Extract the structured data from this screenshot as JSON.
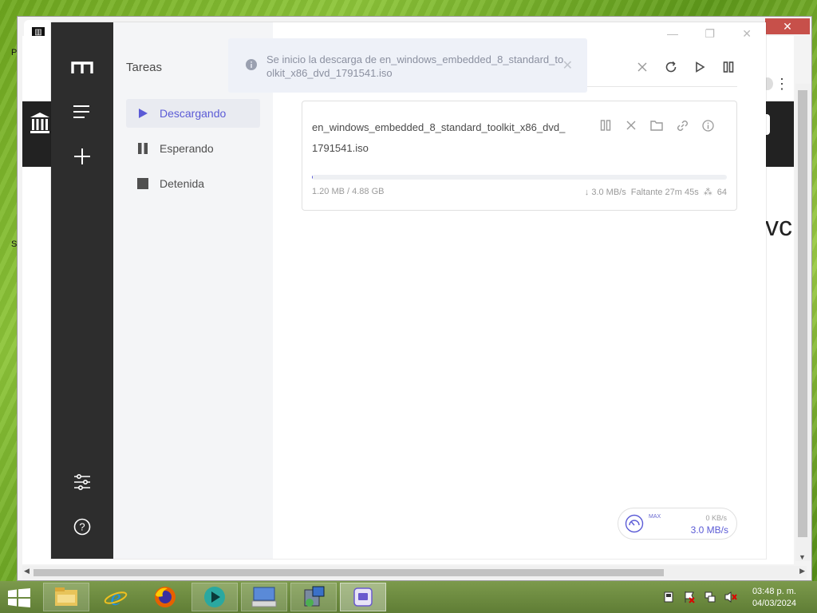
{
  "desktop": {
    "left_letters": [
      "P",
      "S"
    ]
  },
  "browser": {
    "close_label": "✕",
    "back_label": "←",
    "partial_text": "dvc"
  },
  "app": {
    "window_controls": {
      "minimize": "—",
      "maximize": "❐",
      "close": "✕"
    },
    "sidebar": {
      "logo_icon": "motrix-logo-icon",
      "items": [
        {
          "name": "menu-icon"
        },
        {
          "name": "add-icon"
        },
        {
          "name": "preferences-icon"
        },
        {
          "name": "help-icon"
        }
      ]
    },
    "subnav": {
      "title": "Tareas",
      "items": [
        {
          "label": "Descargando",
          "icon": "play-icon",
          "active": true
        },
        {
          "label": "Esperando",
          "icon": "pause-icon",
          "active": false
        },
        {
          "label": "Detenida",
          "icon": "stop-icon",
          "active": false
        }
      ]
    },
    "toolbar": {
      "buttons": [
        "close-icon",
        "refresh-icon",
        "resume-all-icon",
        "pause-all-icon"
      ]
    },
    "toast": {
      "message": "Se inicio la descarga de en_windows_embedded_8_standard_toolkit_x86_dvd_1791541.iso",
      "close": "✕"
    },
    "task": {
      "name": "en_windows_embedded_8_standard_toolkit_x86_dvd_1791541.iso",
      "progress": 0.0025,
      "size": "1.20 MB / 4.88 GB",
      "speed": "↓ 3.0 MB/s",
      "remaining": "Faltante 27m 45s",
      "connections": "64",
      "actions": [
        "pause-icon",
        "delete-icon",
        "folder-icon",
        "link-icon",
        "info-icon"
      ]
    },
    "speedometer": {
      "max_label": "MAX",
      "upload": "0 KB/s",
      "download": "3.0 MB/s"
    }
  },
  "taskbar": {
    "apps": [
      {
        "name": "file-explorer-icon",
        "state": "pinned"
      },
      {
        "name": "internet-explorer-icon",
        "state": "normal"
      },
      {
        "name": "firefox-icon",
        "state": "normal"
      },
      {
        "name": "media-app-icon",
        "state": "pinned"
      },
      {
        "name": "keyboard-app-icon",
        "state": "pinned"
      },
      {
        "name": "installer-icon",
        "state": "pinned"
      },
      {
        "name": "motrix-taskbar-icon",
        "state": "active"
      }
    ],
    "clock": {
      "time": "03:48 p. m.",
      "date": "04/03/2024"
    }
  }
}
